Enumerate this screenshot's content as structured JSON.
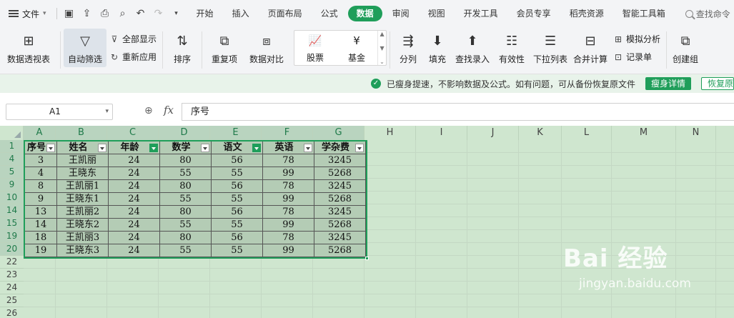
{
  "menubar": {
    "file_label": "文件",
    "tabs": [
      "开始",
      "插入",
      "页面布局",
      "公式",
      "数据",
      "审阅",
      "视图",
      "开发工具",
      "会员专享",
      "稻壳资源",
      "智能工具箱"
    ],
    "active_tab": "数据",
    "search_label": "查找命令"
  },
  "ribbon": {
    "pivot": "数据透视表",
    "autofilter": "自动筛选",
    "show_all": "全部显示",
    "reapply": "重新应用",
    "sort": "排序",
    "duplicate": "重复项",
    "compare": "数据对比",
    "stocks": "股票",
    "funds": "基金",
    "split": "分列",
    "fill": "填充",
    "lookup_entry": "查找录入",
    "validity": "有效性",
    "dropdown_list": "下拉列表",
    "consolidate": "合并计算",
    "simulate": "模拟分析",
    "record_sheet": "记录单",
    "create_group": "创建组"
  },
  "notice": {
    "message": "已瘦身提速，不影响数据及公式。如有问题，可从备份恢复原文件",
    "detail_button": "瘦身详情",
    "restore_button": "恢复原文件"
  },
  "formula_bar": {
    "cell_ref": "A1",
    "formula": "序号"
  },
  "grid": {
    "columns": [
      "A",
      "B",
      "C",
      "D",
      "E",
      "F",
      "G",
      "H",
      "I",
      "J",
      "K",
      "L",
      "M",
      "N"
    ],
    "row_numbers": [
      "1",
      "4",
      "5",
      "9",
      "10",
      "14",
      "15",
      "19",
      "20",
      "22",
      "23",
      "24",
      "25",
      "26"
    ],
    "table_headers": [
      "序号",
      "姓名",
      "年龄",
      "数学",
      "语文",
      "英语",
      "学杂费"
    ],
    "active_filters": [
      "年龄",
      "语文"
    ],
    "rows": [
      [
        "3",
        "王凯丽",
        "24",
        "80",
        "56",
        "78",
        "3245"
      ],
      [
        "4",
        "王晓东",
        "24",
        "55",
        "55",
        "99",
        "5268"
      ],
      [
        "8",
        "王凯丽1",
        "24",
        "80",
        "56",
        "78",
        "3245"
      ],
      [
        "9",
        "王晓东1",
        "24",
        "55",
        "55",
        "99",
        "5268"
      ],
      [
        "13",
        "王凯丽2",
        "24",
        "80",
        "56",
        "78",
        "3245"
      ],
      [
        "14",
        "王晓东2",
        "24",
        "55",
        "55",
        "99",
        "5268"
      ],
      [
        "18",
        "王凯丽3",
        "24",
        "80",
        "56",
        "78",
        "3245"
      ],
      [
        "19",
        "王晓东3",
        "24",
        "55",
        "55",
        "99",
        "5268"
      ]
    ]
  },
  "watermark": {
    "brand": "Bai 经验",
    "url": "jingyan.baidu.com"
  },
  "colors": {
    "accent": "#1f9e5a",
    "sheet_bg": "#cfe6cf",
    "table_bg": "#b4ccb5"
  }
}
